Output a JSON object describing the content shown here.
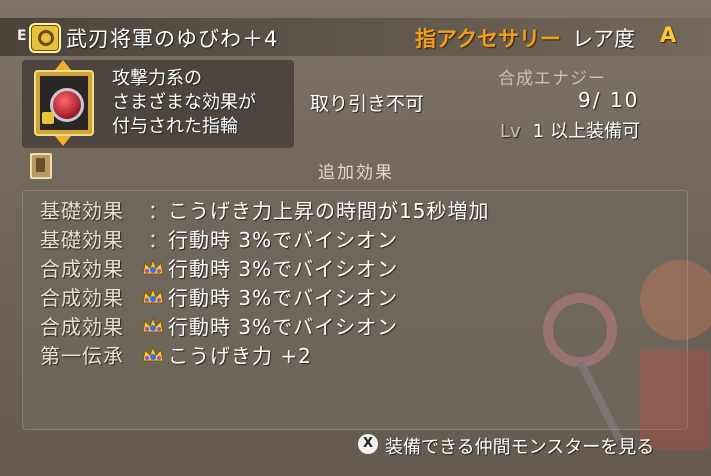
{
  "header": {
    "equip_marker": "E",
    "item_name": "武刃将軍のゆびわ＋4",
    "category": "指アクセサリー",
    "rarity_label": "レア度",
    "rarity_value": "A"
  },
  "item": {
    "icon": "ring-icon",
    "description_lines": [
      "攻撃力系の",
      "さまざまな効果が",
      "付与された指輪"
    ],
    "trade_status": "取り引き不可",
    "synthesis_label": "合成エナジー",
    "synthesis_current": "9",
    "synthesis_max": "10",
    "level_label": "Lv",
    "level_value": "1",
    "level_suffix": "以上装備可"
  },
  "effects": {
    "title": "追加効果",
    "rows": [
      {
        "category": "基礎効果",
        "marker": "：",
        "text": "こうげき力上昇の時間が15秒増加"
      },
      {
        "category": "基礎効果",
        "marker": "：",
        "text": "行動時 3%でバイシオン"
      },
      {
        "category": "合成効果",
        "marker": "crown-icon",
        "text": "行動時 3%でバイシオン"
      },
      {
        "category": "合成効果",
        "marker": "crown-icon",
        "text": "行動時 3%でバイシオン"
      },
      {
        "category": "合成効果",
        "marker": "crown-icon",
        "text": "行動時 3%でバイシオン"
      },
      {
        "category": "第一伝承",
        "marker": "crown-icon",
        "text": "こうげき力 +2"
      }
    ]
  },
  "footer": {
    "button_glyph": "X",
    "label": "装備できる仲間モンスターを見る"
  },
  "colors": {
    "category_orange": "#f0a020",
    "rarity_gold": "#f6c83a"
  }
}
